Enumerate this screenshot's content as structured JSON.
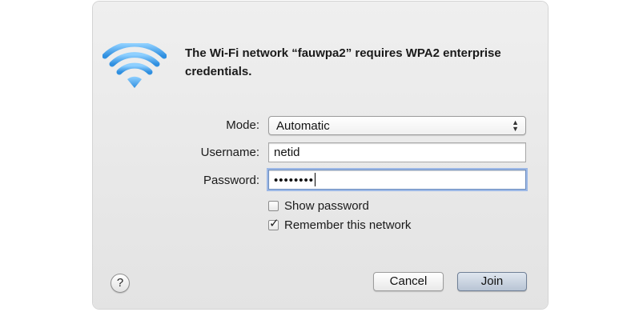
{
  "dialog": {
    "message": "The Wi-Fi network “fauwpa2” requires WPA2 enterprise credentials.",
    "wifi_icon": "wifi-signal-icon",
    "accent_color": "#4aa6e8"
  },
  "form": {
    "mode_label": "Mode:",
    "mode_value": "Automatic",
    "username_label": "Username:",
    "username_value": "netid",
    "password_label": "Password:",
    "password_mask": "••••••••"
  },
  "options": {
    "show_password_label": "Show password",
    "show_password_checked": false,
    "remember_label": "Remember this network",
    "remember_checked": true
  },
  "buttons": {
    "help_label": "?",
    "cancel_label": "Cancel",
    "join_label": "Join"
  }
}
